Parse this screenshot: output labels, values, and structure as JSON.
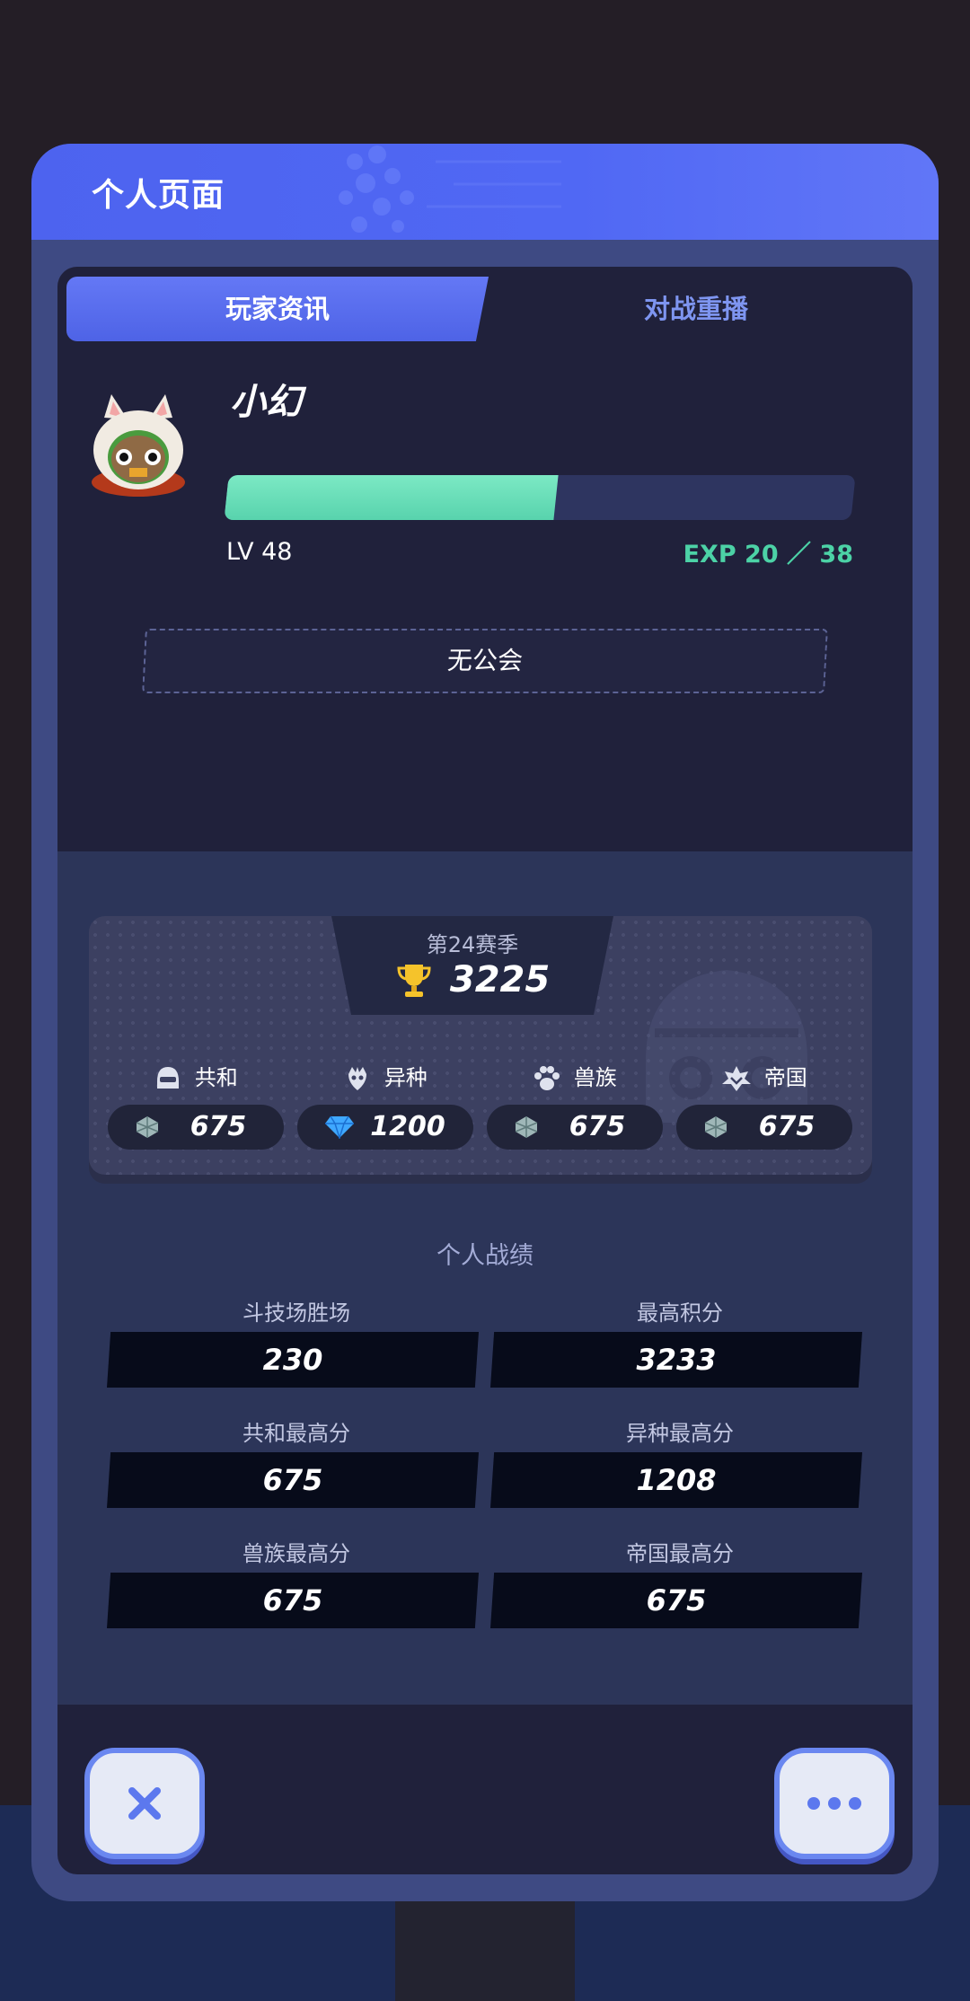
{
  "header": {
    "title": "个人页面"
  },
  "tabs": [
    {
      "label": "玩家资讯",
      "active": true
    },
    {
      "label": "对战重播",
      "active": false
    }
  ],
  "player": {
    "name": "小幻",
    "level_text": "LV 48",
    "exp_text": "EXP 20 ／ 38",
    "exp_current": 20,
    "exp_max": 38,
    "guild": "无公会"
  },
  "season": {
    "label": "第24赛季",
    "score": "3225"
  },
  "factions": [
    {
      "name": "共和",
      "value": "675",
      "icon": "helmet-icon",
      "gem": "gray-gem-icon"
    },
    {
      "name": "异种",
      "value": "1200",
      "icon": "alien-icon",
      "gem": "blue-diamond-icon"
    },
    {
      "name": "兽族",
      "value": "675",
      "icon": "paw-icon",
      "gem": "gray-gem-icon"
    },
    {
      "name": "帝国",
      "value": "675",
      "icon": "empire-icon",
      "gem": "gray-gem-icon"
    }
  ],
  "stats": {
    "title": "个人战绩",
    "items": [
      {
        "label": "斗技场胜场",
        "value": "230"
      },
      {
        "label": "最高积分",
        "value": "3233"
      },
      {
        "label": "共和最高分",
        "value": "675"
      },
      {
        "label": "异种最高分",
        "value": "1208"
      },
      {
        "label": "兽族最高分",
        "value": "675"
      },
      {
        "label": "帝国最高分",
        "value": "675"
      }
    ]
  },
  "colors": {
    "accent": "#5068f4",
    "exp": "#58d3ad",
    "panel": "#20213b"
  }
}
